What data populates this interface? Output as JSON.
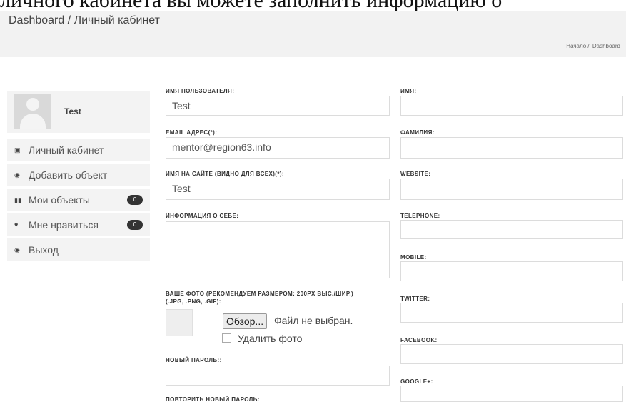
{
  "top_banner": {
    "text": "личного кабинета вы можете заполнить информацию о"
  },
  "header": {
    "title": "Dashboard / Личный кабинет",
    "breadcrumb": [
      "Начало /",
      "Dashboard"
    ]
  },
  "profile": {
    "name": "Test"
  },
  "sidebar": {
    "items": [
      {
        "label": "Личный кабинет",
        "icon": "square-icon"
      },
      {
        "label": "Добавить объект",
        "icon": "circle-plus-icon"
      },
      {
        "label": "Мои объекты",
        "icon": "bars-icon",
        "badge": "0"
      },
      {
        "label": "Мне нравиться",
        "icon": "heart-icon",
        "badge": "0"
      },
      {
        "label": "Выход",
        "icon": "power-icon"
      }
    ]
  },
  "form": {
    "left": {
      "username": {
        "label": "ИМЯ ПОЛЬЗОВАТЕЛЯ:",
        "value": "Test"
      },
      "email": {
        "label": "EMAIL АДРЕС(*):",
        "value": "mentor@region63.info"
      },
      "display_name": {
        "label": "ИМЯ НА САЙТЕ (ВИДНО ДЛЯ ВСЕХ)(*):",
        "value": "Test"
      },
      "about": {
        "label": "ИНФОРМАЦИЯ О СЕБЕ:",
        "value": ""
      },
      "photo": {
        "label_line1": "ВАШЕ ФОТО (РЕКОМЕНДУЕМ РАЗМЕРОМ: 200PX ВЫС./ШИР.)",
        "label_line2": "(.JPG, .PNG, .GIF):",
        "browse_button": "Обзор...",
        "no_file": "Файл не выбран.",
        "delete_label": "Удалить фото"
      },
      "new_password": {
        "label": "НОВЫЙ ПАРОЛЬ::",
        "value": ""
      },
      "repeat_password": {
        "label": "ПОВТОРИТЬ НОВЫЙ ПАРОЛЬ:"
      }
    },
    "right": {
      "first_name": {
        "label": "ИМЯ:",
        "value": ""
      },
      "last_name": {
        "label": "ФАМИЛИЯ:",
        "value": ""
      },
      "website": {
        "label": "WEBSITE:",
        "value": ""
      },
      "telephone": {
        "label": "TELEPHONE:",
        "value": ""
      },
      "mobile": {
        "label": "MOBILE:",
        "value": ""
      },
      "twitter": {
        "label": "TWITTER:",
        "value": ""
      },
      "facebook": {
        "label": "FACEBOOK:",
        "value": ""
      },
      "google": {
        "label": "GOOGLE+:",
        "value": ""
      }
    }
  }
}
